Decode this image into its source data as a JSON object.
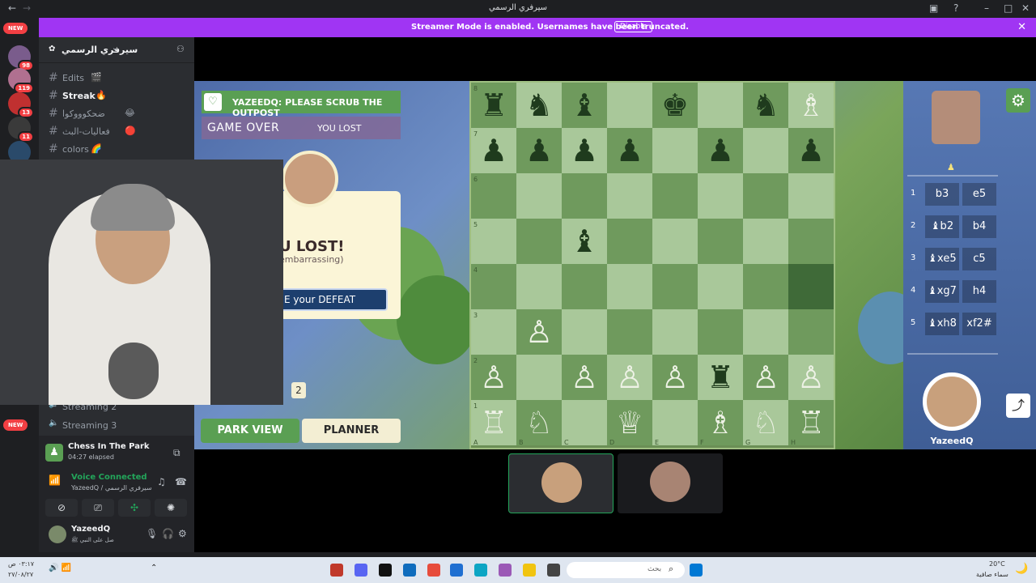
{
  "window": {
    "title": "سيرفري الرسمي"
  },
  "banner": {
    "message": "Streamer Mode is enabled. Usernames have been truncated.",
    "disable_label": "Disable",
    "close_icon": "✕"
  },
  "guilds": {
    "new_label": "NEW",
    "badges": [
      "98",
      "119",
      "13",
      "11"
    ]
  },
  "server": {
    "name": "سيرفري الرسمي"
  },
  "channels": [
    {
      "name": "Edits",
      "emoji": "🎬",
      "active": false
    },
    {
      "name": "Streak",
      "emoji": "🔥",
      "active": true
    },
    {
      "name": "ضحكوووكوا",
      "emoji": "😂",
      "active": false
    },
    {
      "name": "فعاليات-البث",
      "emoji": "🔴",
      "active": false
    },
    {
      "name": "colors",
      "emoji": "🌈",
      "active": false
    }
  ],
  "voice_channels": [
    {
      "name": "Streaming 2"
    },
    {
      "name": "Streaming 3"
    }
  ],
  "activity": {
    "name": "Chess In The Park",
    "elapsed": "04:27 elapsed"
  },
  "voice": {
    "status": "Voice Connected",
    "detail": "YazeedQ / سيرفري الرسمي"
  },
  "user": {
    "name": "YazeedQ",
    "status": "صل على النبي ﷺ"
  },
  "game": {
    "toast": "YAZEEDQ: PLEASE SCRUB THE OUTPOST",
    "game_over": "GAME OVER",
    "result": "YOU LOST",
    "lost_title": "U LOST!",
    "lost_sub": "embarrassing)",
    "defeat_button": "E your DEFEAT",
    "count": "2",
    "park_view": "PARK VIEW",
    "planner": "PLANNER",
    "player_name": "YazeedQ",
    "moves": [
      {
        "n": "1",
        "w": "b3",
        "b": "e5"
      },
      {
        "n": "2",
        "w": "♝b2",
        "b": "b4"
      },
      {
        "n": "3",
        "w": "♝xe5",
        "b": "c5"
      },
      {
        "n": "4",
        "w": "♝xg7",
        "b": "h4"
      },
      {
        "n": "5",
        "w": "♝xh8",
        "b": "xf2#"
      }
    ],
    "ranks": [
      "8",
      "7",
      "6",
      "5",
      "4",
      "3",
      "2",
      "1"
    ],
    "files": [
      "A",
      "B",
      "C",
      "D",
      "E",
      "F",
      "G",
      "H"
    ]
  },
  "taskbar": {
    "time": "٠٣:١٧ ص",
    "date": "٢٧/٠٨/٢٧",
    "search_placeholder": "بحث",
    "weather_temp": "20°C",
    "weather_desc": "سماء صافية"
  },
  "colors": {
    "accent": "#a035f3",
    "green": "#5a9f53"
  }
}
